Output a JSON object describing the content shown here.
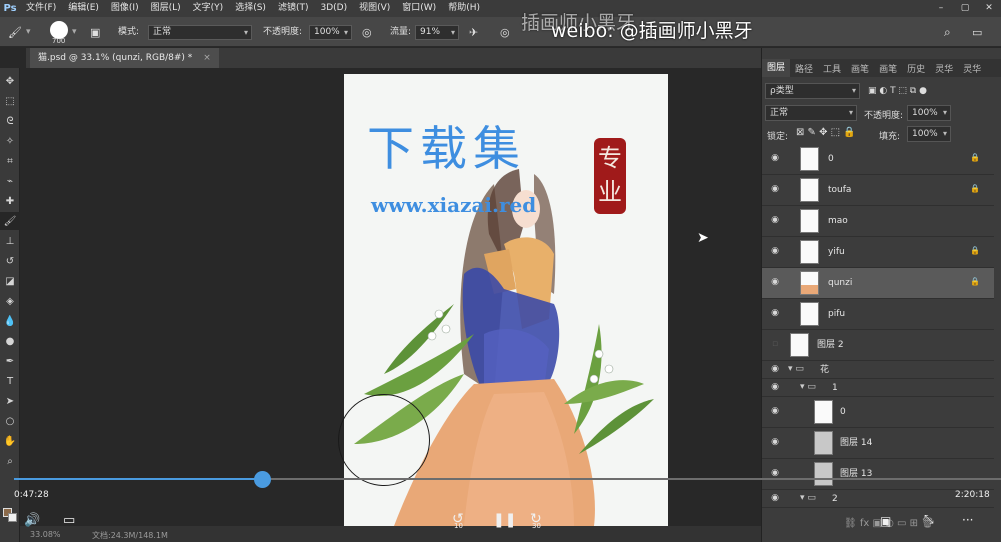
{
  "menubar": {
    "logo": "Ps",
    "items": [
      "文件(F)",
      "编辑(E)",
      "图像(I)",
      "图层(L)",
      "文字(Y)",
      "选择(S)",
      "滤镜(T)",
      "3D(D)",
      "视图(V)",
      "窗口(W)",
      "帮助(H)"
    ],
    "window_controls": [
      "–",
      "▢",
      "✕"
    ]
  },
  "optionsbar": {
    "brush_size": "700",
    "mode_label": "模式:",
    "mode_value": "正常",
    "opacity_label": "不透明度:",
    "opacity_value": "100%",
    "flow_label": "流量:",
    "flow_value": "91%"
  },
  "document": {
    "tab_title": "猫.psd @ 33.1% (qunzi, RGB/8#) *",
    "tab_close": "×"
  },
  "status": {
    "zoom": "33.08%",
    "doc_info": "文档:24.3M/148.1M"
  },
  "watermark": {
    "weibo": "weibo: @插画师小黑牙",
    "weibo_ghost": "插画师小黑牙",
    "title": "下载集",
    "badge": "专业",
    "url": "www.xiazai.red"
  },
  "layers_panel": {
    "tabs": [
      "图层",
      "路径",
      "工具",
      "画笔",
      "画笔",
      "历史",
      "灵华",
      "灵华"
    ],
    "filter_kind": "ρ类型",
    "blend_mode": "正常",
    "opacity_label": "不透明度:",
    "opacity_value": "100%",
    "lock_label": "锁定:",
    "fill_label": "填充:",
    "fill_value": "100%",
    "layers": [
      {
        "name": "0",
        "locked": true
      },
      {
        "name": "toufa",
        "locked": true
      },
      {
        "name": "mao",
        "locked": false
      },
      {
        "name": "yifu",
        "locked": true
      },
      {
        "name": "qunzi",
        "locked": true
      },
      {
        "name": "pifu",
        "locked": false
      },
      {
        "name": "图层 2",
        "locked": false
      }
    ],
    "group_flower": "花",
    "group_1": "1",
    "sub_layers": [
      "0",
      "图层 14",
      "图层 13"
    ],
    "group_2": "2"
  },
  "video": {
    "current_time": "0:47:28",
    "total_time": "2:20:18",
    "progress": 0.25,
    "rewind_label": "10",
    "forward_label": "30"
  },
  "colors": {
    "accent": "#4a9be0",
    "watermark_blue": "#3e8ee0",
    "badge_red": "#a01a1a"
  }
}
